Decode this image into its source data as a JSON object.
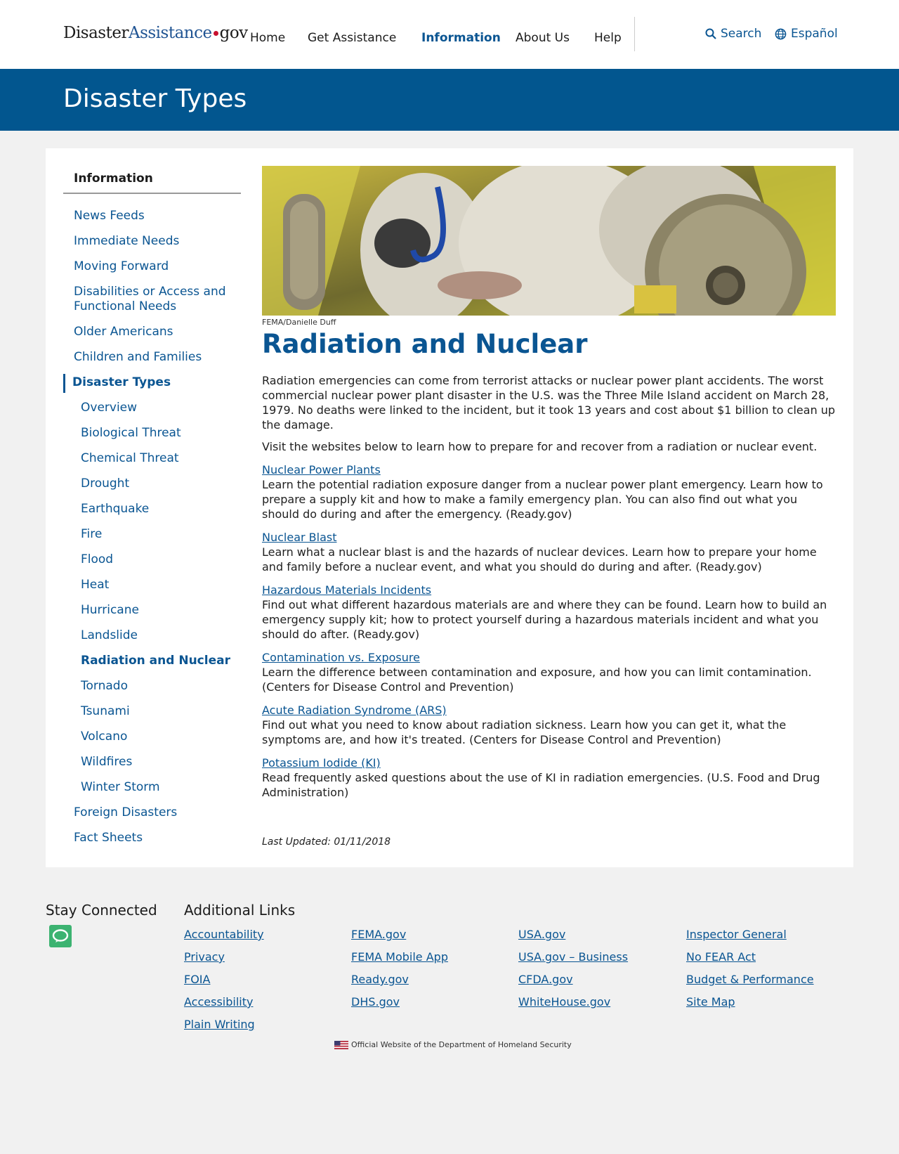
{
  "header": {
    "logo": {
      "part1": "Disaster",
      "part2": "Assistance",
      "part3": "gov"
    },
    "nav": [
      {
        "label": "Home",
        "active": false
      },
      {
        "label": "Get Assistance",
        "active": false
      },
      {
        "label": "Information",
        "active": true
      },
      {
        "label": "About Us",
        "active": false
      },
      {
        "label": "Help",
        "active": false
      }
    ],
    "search_label": "Search",
    "language_label": "Español"
  },
  "banner": {
    "title": "Disaster Types"
  },
  "sidebar": {
    "heading": "Information",
    "items": [
      "News Feeds",
      "Immediate Needs",
      "Moving Forward",
      "Disabilities or Access and Functional Needs",
      "Older Americans",
      "Children and Families",
      "Disaster Types"
    ],
    "sub_items": [
      "Overview",
      "Biological Threat",
      "Chemical Threat",
      "Drought",
      "Earthquake",
      "Fire",
      "Flood",
      "Heat",
      "Hurricane",
      "Landslide",
      "Radiation and Nuclear",
      "Tornado",
      "Tsunami",
      "Volcano",
      "Wildfires",
      "Winter Storm"
    ],
    "after_items": [
      "Foreign Disasters",
      "Fact Sheets"
    ]
  },
  "main": {
    "photo_credit": "FEMA/Danielle Duff",
    "title": "Radiation and Nuclear",
    "intro": "Radiation emergencies can come from terrorist attacks or nuclear power plant accidents. The worst commercial nuclear power plant disaster in the U.S. was the Three Mile Island accident on March 28, 1979. No deaths were linked to the incident, but it took 13 years and cost about $1 billion to clean up the damage.",
    "visit": "Visit the websites below to learn how to prepare for and recover from a radiation or nuclear event.",
    "resources": [
      {
        "title": "Nuclear Power Plants",
        "desc": " Learn the potential radiation exposure danger from a nuclear power plant emergency. Learn how to prepare a supply kit and how to make a family emergency plan. You can also find out what you should do during and after the emergency. (Ready.gov)"
      },
      {
        "title": "Nuclear Blast",
        "desc": "Learn what a nuclear blast is and the hazards of nuclear devices. Learn how to prepare your home and family before a nuclear event, and what you should do during and after. (Ready.gov)"
      },
      {
        "title": "Hazardous Materials Incidents",
        "desc": "Find out what different hazardous materials are and where they can be found. Learn how to build an emergency supply kit; how to protect yourself during a hazardous materials incident and what you should do after. (Ready.gov)"
      },
      {
        "title": "Contamination vs. Exposure",
        "desc": "Learn the difference between contamination and exposure, and how you can limit contamination. (Centers for Disease Control and Prevention)"
      },
      {
        "title": "Acute Radiation Syndrome (ARS)",
        "desc": "Find out what you need to know about radiation sickness. Learn how you can get it, what the symptoms are, and how it's treated. (Centers for Disease Control and Prevention)"
      },
      {
        "title": "Potassium Iodide (KI)",
        "desc": "Read frequently asked questions about the use of KI in radiation emergencies. (U.S. Food and Drug Administration)"
      }
    ],
    "last_updated": "Last Updated: 01/11/2018"
  },
  "footer": {
    "stay_connected": "Stay Connected",
    "additional_links": "Additional Links",
    "columns": [
      [
        "Accountability",
        "Privacy",
        "FOIA",
        "Accessibility",
        "Plain Writing"
      ],
      [
        "FEMA.gov",
        "FEMA Mobile App",
        "Ready.gov",
        "DHS.gov"
      ],
      [
        "USA.gov",
        "USA.gov – Business",
        "CFDA.gov",
        "WhiteHouse.gov"
      ],
      [
        "Inspector General",
        "No FEAR Act",
        "Budget & Performance",
        "Site Map"
      ]
    ],
    "official": "Official Website of the Department of Homeland Security"
  },
  "colors": {
    "brand_blue": "#02568f",
    "link_blue": "#0a5592",
    "logo_dot": "#c8102e",
    "chat_green": "#3cb371"
  }
}
